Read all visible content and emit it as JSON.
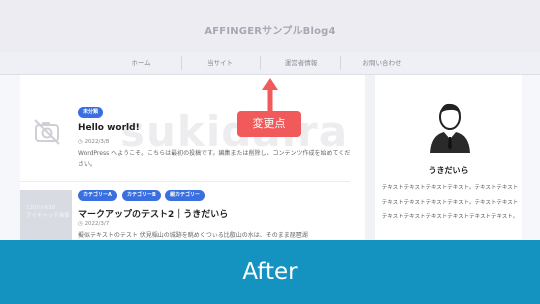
{
  "header": {
    "site_title": "AFFINGERサンプルBlog4"
  },
  "nav": {
    "items": [
      {
        "label": "ホーム"
      },
      {
        "label": "当サイト"
      },
      {
        "label": "運営者情報"
      },
      {
        "label": "お問い合わせ"
      }
    ]
  },
  "watermark": {
    "text": "sukidaira"
  },
  "posts": [
    {
      "badges": [
        "未分類"
      ],
      "title": "Hello world!",
      "date": "2022/3/8",
      "excerpt": "WordPress へようこそ。こちらは最初の投稿です。編集または削除し、コンテンツ作成を始めてください。"
    },
    {
      "badges": [
        "カテゴリーA",
        "カテゴリーB",
        "親カテゴリー"
      ],
      "title": "マークアップのテスト2｜うきだいら",
      "date": "2022/3/7",
      "excerpt": "擬似テキストのテスト 伏見稲山の城跡を眺めくつぃる比叡山の水は、そのまま琵琶湖",
      "thumb_text": [
        "1200×630",
        "アイキャッチ画像"
      ]
    }
  ],
  "sidebar": {
    "author_name": "うきだいら",
    "bio": "テキストテキストテキストテキスト。テキストテキストテキストテキストテキストテキスト。テキストテキストテキストテキストテキストテキストテキストテキスト。"
  },
  "annotation": {
    "label": "変更点",
    "color": "#f05a5a"
  },
  "banner": {
    "label": "After",
    "color": "#1593c0"
  },
  "accent_color": "#3a6fe0"
}
